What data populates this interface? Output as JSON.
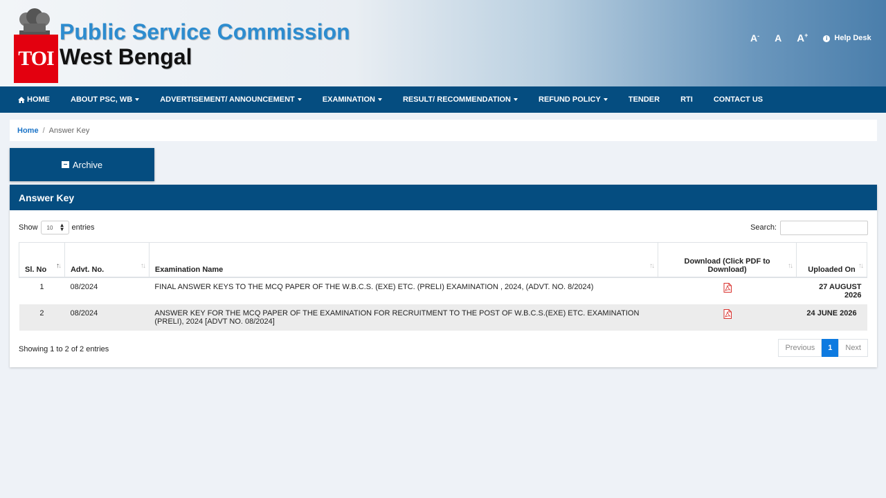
{
  "header": {
    "org_name": "Public Service Commission",
    "org_sub": "West Bengal",
    "toi_badge": "TOI",
    "font_decrease": "A",
    "font_decrease_mark": "-",
    "font_normal": "A",
    "font_increase": "A",
    "font_increase_mark": "+",
    "help_desk": "Help Desk"
  },
  "nav": {
    "items": [
      {
        "label": "HOME"
      },
      {
        "label": "ABOUT PSC, WB"
      },
      {
        "label": "ADVERTISEMENT/ ANNOUNCEMENT"
      },
      {
        "label": "EXAMINATION"
      },
      {
        "label": "RESULT/ RECOMMENDATION"
      },
      {
        "label": "REFUND POLICY"
      },
      {
        "label": "TENDER"
      },
      {
        "label": "RTI"
      },
      {
        "label": "CONTACT US"
      }
    ]
  },
  "breadcrumb": {
    "home": "Home",
    "separator": "/",
    "current": "Answer Key"
  },
  "archive": {
    "label": "Archive"
  },
  "card": {
    "title": "Answer Key",
    "show_label": "Show",
    "entries_label": "entries",
    "page_length": "10",
    "search_label": "Search:",
    "search_value": "",
    "columns": [
      "Sl. No",
      "Advt. No.",
      "Examination Name",
      "Download (Click PDF to Download)",
      "Uploaded On"
    ],
    "rows": [
      {
        "sl": "1",
        "advt": "08/2024",
        "exam": "FINAL ANSWER KEYS TO THE MCQ PAPER OF THE W.B.C.S. (EXE) ETC. (PRELI) EXAMINATION , 2024, (ADVT. NO. 8/2024)",
        "uploaded": "27 AUGUST 2026"
      },
      {
        "sl": "2",
        "advt": "08/2024",
        "exam": "ANSWER KEY FOR THE MCQ PAPER OF THE EXAMINATION FOR RECRUITMENT TO THE POST OF W.B.C.S.(EXE) ETC. EXAMINATION (PRELI), 2024 [ADVT NO. 08/2024]",
        "uploaded": "24 JUNE 2026"
      }
    ],
    "info": "Showing 1 to 2 of 2 entries",
    "pager": {
      "previous": "Previous",
      "current": "1",
      "next": "Next"
    }
  },
  "colors": {
    "primary": "#054d80",
    "pdf": "#d9302c",
    "link": "#1a73c7",
    "page_active": "#0d7ae0",
    "toi": "#e3000f"
  }
}
